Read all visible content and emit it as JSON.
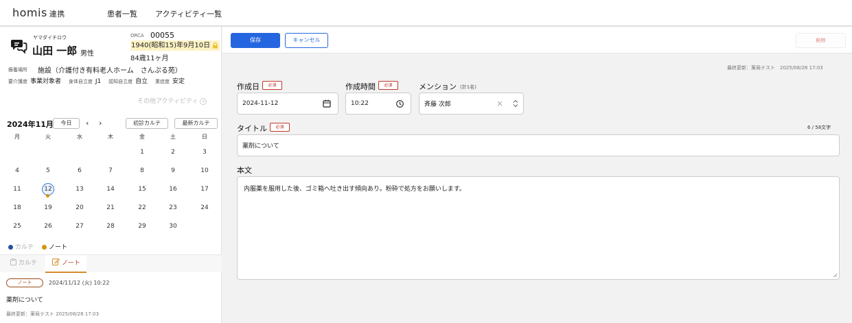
{
  "nav": {
    "logo": "homis",
    "logo_sub": "連携",
    "links": [
      "患者一覧",
      "アクティビティ一覧"
    ]
  },
  "patient": {
    "kana": "ヤマダイチロウ",
    "name": "山田 一郎",
    "sex": "男性",
    "orca_label": "ORCA",
    "orca_id": "00055",
    "dob": "1940(昭和15)年9月10日",
    "age": "84歳11ヶ月",
    "location_label": "療養場所",
    "location": "施設（介護付き有料老人ホーム　さんぷる苑）",
    "care": [
      {
        "label": "要介護度",
        "value": "事業対象者"
      },
      {
        "label": "身体自立度",
        "value": "J1"
      },
      {
        "label": "認知自立度",
        "value": "自立"
      },
      {
        "label": "重症度",
        "value": "安定"
      }
    ],
    "other_activity": "その他アクティビティ"
  },
  "calendar": {
    "title": "2024年11月",
    "today_btn": "今日",
    "first_chart_btn": "初診カルテ",
    "latest_chart_btn": "最新カルテ",
    "weekdays": [
      "月",
      "火",
      "水",
      "木",
      "金",
      "土",
      "日"
    ],
    "weeks": [
      [
        "",
        "",
        "",
        "",
        "1",
        "2",
        "3"
      ],
      [
        "4",
        "5",
        "6",
        "7",
        "8",
        "9",
        "10"
      ],
      [
        "11",
        "12",
        "13",
        "14",
        "15",
        "16",
        "17"
      ],
      [
        "18",
        "19",
        "20",
        "21",
        "22",
        "23",
        "24"
      ],
      [
        "25",
        "26",
        "27",
        "28",
        "29",
        "30",
        ""
      ]
    ],
    "selected_day": "12",
    "legend": [
      {
        "label": "カルテ",
        "color": "#2a4fa3"
      },
      {
        "label": "ノート",
        "color": "#d4920e"
      }
    ]
  },
  "tabs": {
    "chart": "カルテ",
    "note": "ノート"
  },
  "note_item": {
    "badge": "ノート",
    "datetime": "2024/11/12 (火) 10:22",
    "title": "薬剤について",
    "updated": "最終更新：薬局テスト 2025/08/28 17:03"
  },
  "form": {
    "save": "保存",
    "cancel": "キャンセル",
    "delete": "削除",
    "last_updated": "最終更新：薬局テスト　2025/08/28 17:03",
    "required": "必須",
    "date_label": "作成日",
    "date_value": "2024-11-12",
    "time_label": "作成時間",
    "time_value": "10:22",
    "mention_label": "メンション",
    "mention_count": "(計1名)",
    "mention_value": "斉藤 次郎",
    "title_label": "タイトル",
    "title_value": "薬剤について",
    "title_counter": "6 / 58文字",
    "body_label": "本文",
    "body_value": "内服薬を服用した後、ゴミ箱へ吐き出す傾向あり。粉砕で処方をお願いします。"
  }
}
